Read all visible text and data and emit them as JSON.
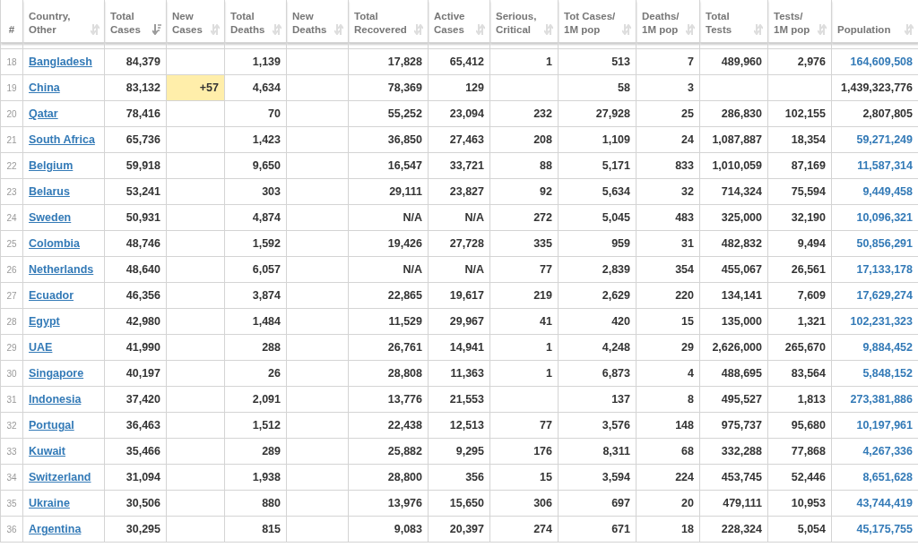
{
  "columns": [
    {
      "label": "#",
      "sortable": false
    },
    {
      "label": "Country, Other",
      "sortable": true,
      "sorted": false
    },
    {
      "label": "Total Cases",
      "sortable": true,
      "sorted": true
    },
    {
      "label": "New Cases",
      "sortable": true,
      "sorted": false
    },
    {
      "label": "Total Deaths",
      "sortable": true,
      "sorted": false
    },
    {
      "label": "New Deaths",
      "sortable": true,
      "sorted": false
    },
    {
      "label": "Total Recovered",
      "sortable": true,
      "sorted": false
    },
    {
      "label": "Active Cases",
      "sortable": true,
      "sorted": false
    },
    {
      "label": "Serious, Critical",
      "sortable": true,
      "sorted": false
    },
    {
      "label": "Tot Cases/ 1M pop",
      "sortable": true,
      "sorted": false
    },
    {
      "label": "Deaths/ 1M pop",
      "sortable": true,
      "sorted": false
    },
    {
      "label": "Total Tests",
      "sortable": true,
      "sorted": false
    },
    {
      "label": "Tests/ 1M pop",
      "sortable": true,
      "sorted": false
    },
    {
      "label": "Population",
      "sortable": true,
      "sorted": false
    }
  ],
  "rows": [
    {
      "rank": "18",
      "country": "Bangladesh",
      "total_cases": "84,379",
      "total_deaths": "1,139",
      "total_recovered": "17,828",
      "active_cases": "65,412",
      "serious": "1",
      "cases_per_1m": "513",
      "deaths_per_1m": "7",
      "total_tests": "489,960",
      "tests_per_1m": "2,976",
      "population": "164,609,508",
      "population_link": true
    },
    {
      "rank": "19",
      "country": "China",
      "total_cases": "83,132",
      "new_cases": "+57",
      "total_deaths": "4,634",
      "total_recovered": "78,369",
      "active_cases": "129",
      "cases_per_1m": "58",
      "deaths_per_1m": "3",
      "population": "1,439,323,776",
      "population_link": false
    },
    {
      "rank": "20",
      "country": "Qatar",
      "total_cases": "78,416",
      "total_deaths": "70",
      "total_recovered": "55,252",
      "active_cases": "23,094",
      "serious": "232",
      "cases_per_1m": "27,928",
      "deaths_per_1m": "25",
      "total_tests": "286,830",
      "tests_per_1m": "102,155",
      "population": "2,807,805",
      "population_link": false
    },
    {
      "rank": "21",
      "country": "South Africa",
      "total_cases": "65,736",
      "total_deaths": "1,423",
      "total_recovered": "36,850",
      "active_cases": "27,463",
      "serious": "208",
      "cases_per_1m": "1,109",
      "deaths_per_1m": "24",
      "total_tests": "1,087,887",
      "tests_per_1m": "18,354",
      "population": "59,271,249",
      "population_link": true
    },
    {
      "rank": "22",
      "country": "Belgium",
      "total_cases": "59,918",
      "total_deaths": "9,650",
      "total_recovered": "16,547",
      "active_cases": "33,721",
      "serious": "88",
      "cases_per_1m": "5,171",
      "deaths_per_1m": "833",
      "total_tests": "1,010,059",
      "tests_per_1m": "87,169",
      "population": "11,587,314",
      "population_link": true
    },
    {
      "rank": "23",
      "country": "Belarus",
      "total_cases": "53,241",
      "total_deaths": "303",
      "total_recovered": "29,111",
      "active_cases": "23,827",
      "serious": "92",
      "cases_per_1m": "5,634",
      "deaths_per_1m": "32",
      "total_tests": "714,324",
      "tests_per_1m": "75,594",
      "population": "9,449,458",
      "population_link": true
    },
    {
      "rank": "24",
      "country": "Sweden",
      "total_cases": "50,931",
      "total_deaths": "4,874",
      "total_recovered": "N/A",
      "active_cases": "N/A",
      "serious": "272",
      "cases_per_1m": "5,045",
      "deaths_per_1m": "483",
      "total_tests": "325,000",
      "tests_per_1m": "32,190",
      "population": "10,096,321",
      "population_link": true
    },
    {
      "rank": "25",
      "country": "Colombia",
      "total_cases": "48,746",
      "total_deaths": "1,592",
      "total_recovered": "19,426",
      "active_cases": "27,728",
      "serious": "335",
      "cases_per_1m": "959",
      "deaths_per_1m": "31",
      "total_tests": "482,832",
      "tests_per_1m": "9,494",
      "population": "50,856,291",
      "population_link": true
    },
    {
      "rank": "26",
      "country": "Netherlands",
      "total_cases": "48,640",
      "total_deaths": "6,057",
      "total_recovered": "N/A",
      "active_cases": "N/A",
      "serious": "77",
      "cases_per_1m": "2,839",
      "deaths_per_1m": "354",
      "total_tests": "455,067",
      "tests_per_1m": "26,561",
      "population": "17,133,178",
      "population_link": true
    },
    {
      "rank": "27",
      "country": "Ecuador",
      "total_cases": "46,356",
      "total_deaths": "3,874",
      "total_recovered": "22,865",
      "active_cases": "19,617",
      "serious": "219",
      "cases_per_1m": "2,629",
      "deaths_per_1m": "220",
      "total_tests": "134,141",
      "tests_per_1m": "7,609",
      "population": "17,629,274",
      "population_link": true
    },
    {
      "rank": "28",
      "country": "Egypt",
      "total_cases": "42,980",
      "total_deaths": "1,484",
      "total_recovered": "11,529",
      "active_cases": "29,967",
      "serious": "41",
      "cases_per_1m": "420",
      "deaths_per_1m": "15",
      "total_tests": "135,000",
      "tests_per_1m": "1,321",
      "population": "102,231,323",
      "population_link": true
    },
    {
      "rank": "29",
      "country": "UAE",
      "total_cases": "41,990",
      "total_deaths": "288",
      "total_recovered": "26,761",
      "active_cases": "14,941",
      "serious": "1",
      "cases_per_1m": "4,248",
      "deaths_per_1m": "29",
      "total_tests": "2,626,000",
      "tests_per_1m": "265,670",
      "population": "9,884,452",
      "population_link": true
    },
    {
      "rank": "30",
      "country": "Singapore",
      "total_cases": "40,197",
      "total_deaths": "26",
      "total_recovered": "28,808",
      "active_cases": "11,363",
      "serious": "1",
      "cases_per_1m": "6,873",
      "deaths_per_1m": "4",
      "total_tests": "488,695",
      "tests_per_1m": "83,564",
      "population": "5,848,152",
      "population_link": true
    },
    {
      "rank": "31",
      "country": "Indonesia",
      "total_cases": "37,420",
      "total_deaths": "2,091",
      "total_recovered": "13,776",
      "active_cases": "21,553",
      "cases_per_1m": "137",
      "deaths_per_1m": "8",
      "total_tests": "495,527",
      "tests_per_1m": "1,813",
      "population": "273,381,886",
      "population_link": true
    },
    {
      "rank": "32",
      "country": "Portugal",
      "total_cases": "36,463",
      "total_deaths": "1,512",
      "total_recovered": "22,438",
      "active_cases": "12,513",
      "serious": "77",
      "cases_per_1m": "3,576",
      "deaths_per_1m": "148",
      "total_tests": "975,737",
      "tests_per_1m": "95,680",
      "population": "10,197,961",
      "population_link": true
    },
    {
      "rank": "33",
      "country": "Kuwait",
      "total_cases": "35,466",
      "total_deaths": "289",
      "total_recovered": "25,882",
      "active_cases": "9,295",
      "serious": "176",
      "cases_per_1m": "8,311",
      "deaths_per_1m": "68",
      "total_tests": "332,288",
      "tests_per_1m": "77,868",
      "population": "4,267,336",
      "population_link": true
    },
    {
      "rank": "34",
      "country": "Switzerland",
      "total_cases": "31,094",
      "total_deaths": "1,938",
      "total_recovered": "28,800",
      "active_cases": "356",
      "serious": "15",
      "cases_per_1m": "3,594",
      "deaths_per_1m": "224",
      "total_tests": "453,745",
      "tests_per_1m": "52,446",
      "population": "8,651,628",
      "population_link": true
    },
    {
      "rank": "35",
      "country": "Ukraine",
      "total_cases": "30,506",
      "total_deaths": "880",
      "total_recovered": "13,976",
      "active_cases": "15,650",
      "serious": "306",
      "cases_per_1m": "697",
      "deaths_per_1m": "20",
      "total_tests": "479,111",
      "tests_per_1m": "10,953",
      "population": "43,744,419",
      "population_link": true
    },
    {
      "rank": "36",
      "country": "Argentina",
      "total_cases": "30,295",
      "total_deaths": "815",
      "total_recovered": "9,083",
      "active_cases": "20,397",
      "serious": "274",
      "cases_per_1m": "671",
      "deaths_per_1m": "18",
      "total_tests": "228,324",
      "tests_per_1m": "5,054",
      "population": "45,175,755",
      "population_link": true
    }
  ]
}
